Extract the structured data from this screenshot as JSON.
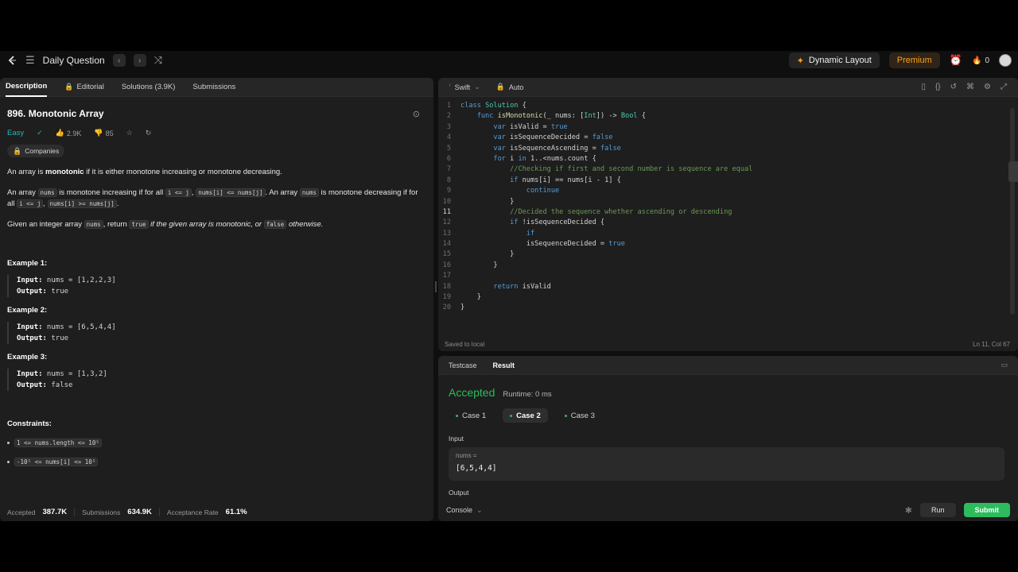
{
  "nav": {
    "title": "Daily Question",
    "dynamic_layout": "Dynamic Layout",
    "premium": "Premium",
    "streak": "0"
  },
  "left": {
    "tabs": [
      "Description",
      "Editorial",
      "Solutions (3.9K)",
      "Submissions"
    ],
    "title": "896. Monotonic Array",
    "difficulty": "Easy",
    "likes": "2.9K",
    "dislikes": "85",
    "companies": "Companies",
    "p1_a": "An array is ",
    "p1_b": "monotonic",
    "p1_c": " if it is either monotone increasing or monotone decreasing.",
    "p2": {
      "a": "An array ",
      "nums": "nums",
      "b": " is monotone increasing if for all ",
      "ij": "i <= j",
      "c": ", ",
      "cmp1": "nums[i] <= nums[j]",
      "d": ". An array ",
      "e": " is monotone decreasing if for all ",
      "f": ", ",
      "cmp2": "nums[i] >= nums[j]",
      "g": "."
    },
    "p3": {
      "a": "Given an integer array ",
      "nums": "nums",
      "b": ", return ",
      "t": "true",
      "c": " if the given array is monotonic, or ",
      "f": "false",
      "d": " otherwise."
    },
    "examples": [
      {
        "title": "Example 1:",
        "input_label": "Input:",
        "input": " nums = [1,2,2,3]",
        "output_label": "Output:",
        "output": " true"
      },
      {
        "title": "Example 2:",
        "input_label": "Input:",
        "input": " nums = [6,5,4,4]",
        "output_label": "Output:",
        "output": " true"
      },
      {
        "title": "Example 3:",
        "input_label": "Input:",
        "input": " nums = [1,3,2]",
        "output_label": "Output:",
        "output": " false"
      }
    ],
    "constraints_title": "Constraints:",
    "constraints": [
      "1 <= nums.length <= 10⁵",
      "-10⁵ <= nums[i] <= 10⁵"
    ],
    "footer": {
      "accepted_label": "Accepted",
      "accepted": "387.7K",
      "submissions_label": "Submissions",
      "submissions": "634.9K",
      "rate_label": "Acceptance Rate",
      "rate": "61.1%"
    }
  },
  "code": {
    "language": "Swift",
    "mode": "Auto",
    "saved": "Saved to local",
    "position": "Ln 11, Col 67",
    "lines": [
      "class Solution {",
      "    func isMonotonic(_ nums: [Int]) -> Bool {",
      "        var isValid = true",
      "        var isSequenceDecided = false",
      "        var isSequenceAscending = false",
      "        for i in 1..<nums.count {",
      "            //Checking if first and second number is sequence are equal",
      "            if nums[i] == nums[i - 1] {",
      "                continue",
      "            }",
      "            //Decided the sequence whether ascending or descending",
      "            if !isSequenceDecided {",
      "                if",
      "                isSequenceDecided = true",
      "            }",
      "        }",
      "",
      "        return isValid",
      "    }",
      "}"
    ]
  },
  "result": {
    "tabs": [
      "Testcase",
      "Result"
    ],
    "status": "Accepted",
    "runtime": "Runtime: 0 ms",
    "cases": [
      "Case 1",
      "Case 2",
      "Case 3"
    ],
    "input_label": "Input",
    "var_label": "nums =",
    "var_value": "[6,5,4,4]",
    "output_label": "Output",
    "console": "Console",
    "run": "Run",
    "submit": "Submit"
  }
}
